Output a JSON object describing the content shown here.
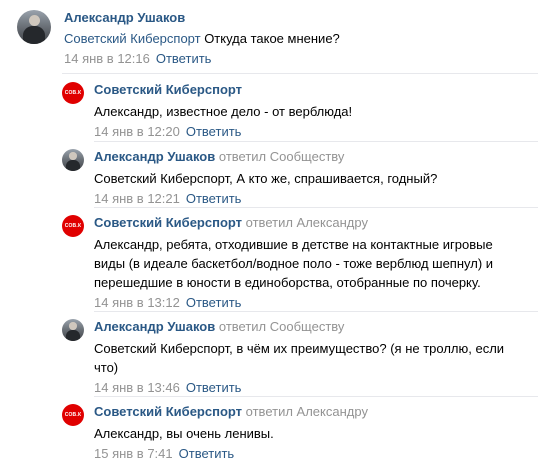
{
  "comments": [
    {
      "author": "Александр Ушаков",
      "replied": "",
      "replied_to": "",
      "mention": "Советский Киберспорт",
      "text": " Откуда такое мнение?",
      "date": "14 янв в 12:16",
      "reply_label": "Ответить",
      "avatar": "user-photo"
    },
    {
      "author": "Советский Киберспорт",
      "replied": "",
      "replied_to": "",
      "mention": "",
      "text": "Александр, известное дело - от верблюда!",
      "date": "14 янв в 12:20",
      "reply_label": "Ответить",
      "avatar": "community-logo",
      "logo_text": "СОВ.К"
    },
    {
      "author": "Александр Ушаков",
      "replied": "ответил",
      "replied_to": "Сообществу",
      "mention": "",
      "text": "Советский Киберспорт, А кто же, спрашивается, годный?",
      "date": "14 янв в 12:21",
      "reply_label": "Ответить",
      "avatar": "user-photo"
    },
    {
      "author": "Советский Киберспорт",
      "replied": "ответил",
      "replied_to": "Александру",
      "mention": "",
      "text": "Александр, ребята, отходившие в детстве на контактные игровые виды (в идеале баскетбол/водное поло - тоже верблюд шепнул) и перешедшие в юности в единоборства, отобранные по почерку.",
      "date": "14 янв в 13:12",
      "reply_label": "Ответить",
      "avatar": "community-logo",
      "logo_text": "СОВ.К"
    },
    {
      "author": "Александр Ушаков",
      "replied": "ответил",
      "replied_to": "Сообществу",
      "mention": "",
      "text": "Советский Киберспорт, в чём их преимущество? (я не троллю, если что)",
      "date": "14 янв в 13:46",
      "reply_label": "Ответить",
      "avatar": "user-photo"
    },
    {
      "author": "Советский Киберспорт",
      "replied": "ответил",
      "replied_to": "Александру",
      "mention": "",
      "text": "Александр, вы очень ленивы.",
      "date": "15 янв в 7:41",
      "reply_label": "Ответить",
      "avatar": "community-logo",
      "logo_text": "СОВ.К"
    }
  ],
  "colors": {
    "link": "#2a5885",
    "muted": "#939393",
    "separator": "#e7e8ec",
    "community_avatar": "#e00000"
  }
}
